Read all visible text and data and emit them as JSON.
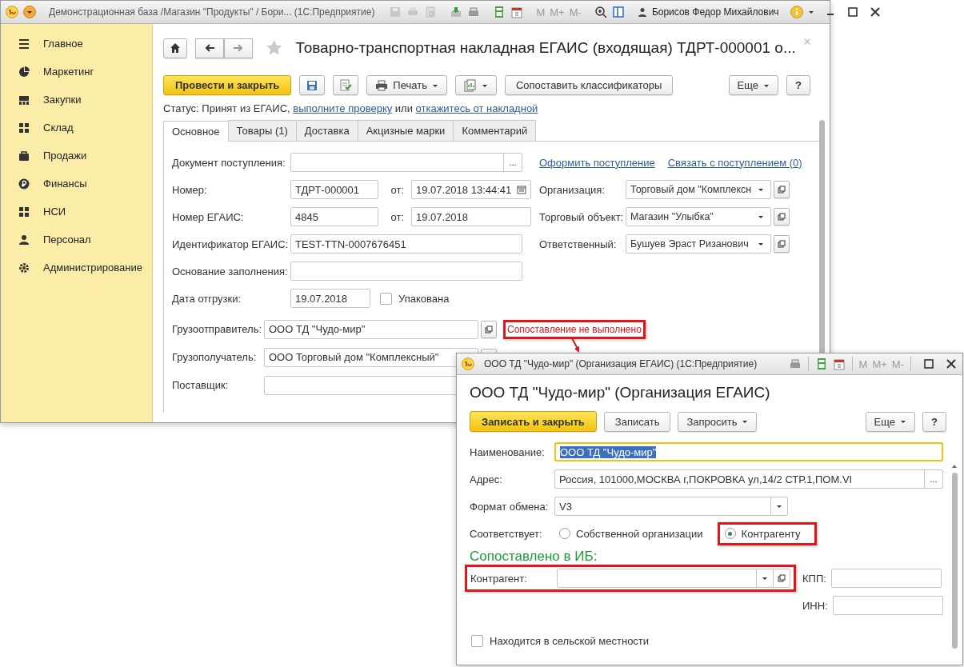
{
  "main_window": {
    "title": "Демонстрационная база /Магазин \"Продукты\" / Бори...  (1С:Предприятие)",
    "memory_buttons": [
      {
        "label": "M",
        "disabled": true
      },
      {
        "label": "M+",
        "disabled": true
      },
      {
        "label": "M-",
        "disabled": true
      }
    ],
    "user": "Борисов Федор Михайлович"
  },
  "sidebar": {
    "items": [
      {
        "label": "Главное"
      },
      {
        "label": "Маркетинг"
      },
      {
        "label": "Закупки"
      },
      {
        "label": "Склад"
      },
      {
        "label": "Продажи"
      },
      {
        "label": "Финансы"
      },
      {
        "label": "НСИ"
      },
      {
        "label": "Персонал"
      },
      {
        "label": "Администрирование"
      }
    ]
  },
  "form": {
    "title": "Товарно-транспортная накладная ЕГАИС (входящая) ТДРТ-000001 о...",
    "post_button": "Провести и закрыть",
    "print_button": "Печать",
    "match_button": "Сопоставить классификаторы",
    "more_button": "Еще",
    "help_button": "?",
    "status": [
      {
        "kind": "text",
        "text": "Статус: Принят из ЕГАИС, "
      },
      {
        "kind": "link",
        "text": "выполните проверку"
      },
      {
        "kind": "text",
        "text": " или "
      },
      {
        "kind": "link",
        "text": "откажитесь от накладной"
      }
    ],
    "tabs": [
      {
        "label": "Основное",
        "selected": true
      },
      {
        "label": "Товары (1)",
        "selected": false
      },
      {
        "label": "Доставка",
        "selected": false
      },
      {
        "label": "Акцизные марки",
        "selected": false
      },
      {
        "label": "Комментарий",
        "selected": false
      }
    ],
    "doc_receipt": {
      "label": "Документ поступления:",
      "choice": "..."
    },
    "links": [
      "Оформить поступление",
      "Связать с поступлением (0)"
    ],
    "number": {
      "label": "Номер:",
      "value": "ТДРТ-000001",
      "date_label": "от:",
      "date": "19.07.2018 13:44:41"
    },
    "egais_number": {
      "label": "Номер ЕГАИС:",
      "value": "4845",
      "date_label": "от:",
      "date": "19.07.2018"
    },
    "egais_id": {
      "label": "Идентификатор ЕГАИС:",
      "value": "TEST-TTN-0007676451"
    },
    "fill_basis": {
      "label": "Основание заполнения:"
    },
    "ship_date": {
      "label": "Дата отгрузки:",
      "value": "19.07.2018"
    },
    "packed": {
      "label": "Упакована",
      "checked": false
    },
    "right_fields": [
      {
        "label": "Организация:",
        "value": "Торговый дом \"Комплексн"
      },
      {
        "label": "Торговый объект:",
        "value": "Магазин \"Улыбка\""
      },
      {
        "label": "Ответственный:",
        "value": "Бушуев Эраст Ризанович"
      }
    ],
    "parties": [
      {
        "label": "Грузоотправитель:",
        "value": "ООО ТД \"Чудо-мир\""
      },
      {
        "label": "Грузополучатель:",
        "value": "ООО Торговый дом \"Комплексный\""
      },
      {
        "label": "Поставщик:"
      }
    ],
    "mismatch_notice": {
      "text": "Сопоставление не выполнено",
      "highlighted": true
    }
  },
  "popup": {
    "window_title": "ООО ТД \"Чудо-мир\" (Организация ЕГАИС)  (1С:Предприятие)",
    "memory_buttons": [
      {
        "label": "M",
        "disabled": true
      },
      {
        "label": "M+",
        "disabled": true
      },
      {
        "label": "M-",
        "disabled": true
      }
    ],
    "heading": "ООО ТД \"Чудо-мир\" (Организация ЕГАИС)",
    "save_close_button": "Записать и закрыть",
    "save_button": "Записать",
    "request_button": "Запросить",
    "more_button": "Еще",
    "help_button": "?",
    "name": {
      "label": "Наименование:",
      "value": "ООО ТД \"Чудо-мир\"",
      "focused": true
    },
    "address": {
      "label": "Адрес:",
      "value": "Россия, 101000,МОСКВА г,ПОКРОВКА ул,14/2 СТР.1,ПОМ.VI",
      "choice": "..."
    },
    "exchange_format": {
      "label": "Формат обмена:",
      "value": "V3"
    },
    "matches": {
      "label": "Соответствует:",
      "options": [
        {
          "label": "Собственной организации",
          "selected": false,
          "highlighted": false
        },
        {
          "label": "Контрагенту",
          "selected": true,
          "highlighted": true
        }
      ]
    },
    "matched_heading": "Сопоставлено в ИБ:",
    "counterparty": {
      "label": "Контрагент:",
      "highlighted": true
    },
    "kpp": {
      "label": "КПП:"
    },
    "inn": {
      "label": "ИНН:"
    },
    "rural": {
      "label": "Находится в сельской местности",
      "checked": false
    }
  }
}
